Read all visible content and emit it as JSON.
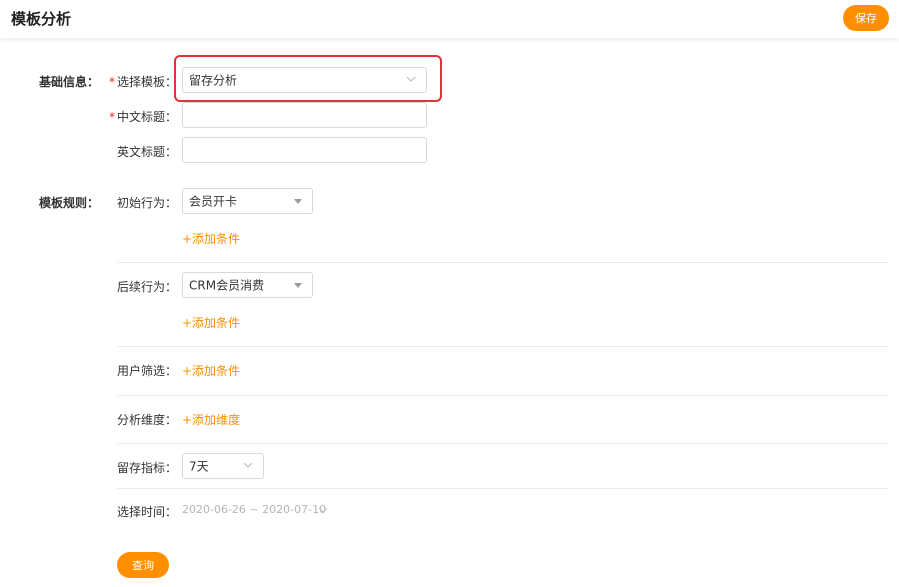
{
  "colors": {
    "accent": "#ff8f00",
    "required": "#f5222d",
    "highlight": "#e5303a"
  },
  "header": {
    "title": "模板分析",
    "save_label": "保存"
  },
  "basic": {
    "section_label": "基础信息：",
    "template_label": "选择模板：",
    "template_value": "留存分析",
    "cn_title_label": "中文标题：",
    "cn_title_value": "",
    "en_title_label": "英文标题：",
    "en_title_value": ""
  },
  "rules": {
    "section_label": "模板规则：",
    "initial_label": "初始行为：",
    "initial_value": "会员开卡",
    "initial_add": "+添加条件",
    "followup_label": "后续行为：",
    "followup_value": "CRM会员消费",
    "followup_add": "+添加条件",
    "user_filter_label": "用户筛选：",
    "user_filter_add": "+添加条件",
    "dimension_label": "分析维度：",
    "dimension_add": "+添加维度",
    "retention_label": "留存指标：",
    "retention_value": "7天",
    "time_label": "选择时间：",
    "time_value": "2020-06-26 ~ 2020-07-10"
  },
  "footer": {
    "query_label": "查询"
  }
}
